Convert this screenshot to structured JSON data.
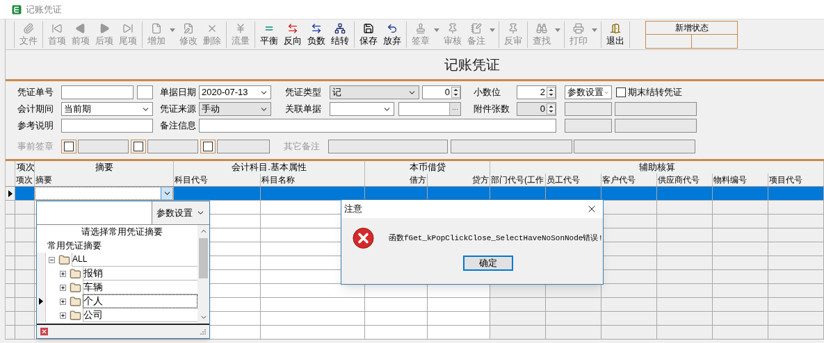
{
  "window": {
    "title": "记账凭证"
  },
  "toolbar": {
    "groups": [
      [
        {
          "label": "文件",
          "disabled": true,
          "dropdown": false
        }
      ],
      [
        {
          "label": "首项",
          "disabled": true,
          "dropdown": false
        },
        {
          "label": "前项",
          "disabled": true,
          "dropdown": false
        },
        {
          "label": "后项",
          "disabled": true,
          "dropdown": false
        },
        {
          "label": "尾项",
          "disabled": true,
          "dropdown": false
        }
      ],
      [
        {
          "label": "增加",
          "disabled": true,
          "dropdown": true
        },
        {
          "label": "修改",
          "disabled": true,
          "dropdown": false
        },
        {
          "label": "删除",
          "disabled": true,
          "dropdown": false
        }
      ],
      [
        {
          "label": "流量",
          "disabled": true,
          "dropdown": false
        }
      ],
      [
        {
          "label": "平衡",
          "disabled": false,
          "dropdown": false
        },
        {
          "label": "反向",
          "disabled": false,
          "dropdown": false
        },
        {
          "label": "负数",
          "disabled": false,
          "dropdown": false
        },
        {
          "label": "结转",
          "disabled": false,
          "dropdown": false
        }
      ],
      [
        {
          "label": "保存",
          "disabled": false,
          "dropdown": false
        },
        {
          "label": "放弃",
          "disabled": false,
          "dropdown": false
        }
      ],
      [
        {
          "label": "签章",
          "disabled": true,
          "dropdown": true
        },
        {
          "label": "审核",
          "disabled": true,
          "dropdown": false
        },
        {
          "label": "备注",
          "disabled": true,
          "dropdown": true
        }
      ],
      [
        {
          "label": "反审",
          "disabled": true,
          "dropdown": false
        }
      ],
      [
        {
          "label": "查找",
          "disabled": true,
          "dropdown": true
        }
      ],
      [
        {
          "label": "打印",
          "disabled": true,
          "dropdown": true
        }
      ],
      [
        {
          "label": "退出",
          "disabled": false,
          "dropdown": false
        }
      ]
    ],
    "status": "新增状态"
  },
  "heading": "记账凭证",
  "form": {
    "voucher_no": {
      "label": "凭证单号"
    },
    "date": {
      "label": "单据日期",
      "value": "2020-07-13"
    },
    "voucher_type": {
      "label": "凭证类型",
      "value": "记",
      "number": "0"
    },
    "decimals": {
      "label": "小数位",
      "value": "2"
    },
    "settings": {
      "value": "参数设置"
    },
    "period_end_transfer": {
      "label": "期末结转凭证",
      "checked": false
    },
    "period": {
      "label": "会计期间",
      "value": "当前期"
    },
    "source": {
      "label": "凭证来源",
      "value": "手动"
    },
    "related_doc": {
      "label": "关联单据",
      "button": "···"
    },
    "attachments": {
      "label": "附件张数",
      "value": "0"
    },
    "reference": {
      "label": "参考说明"
    },
    "remark": {
      "label": "备注信息"
    },
    "pre_signature": {
      "label": "事前签章",
      "disabled": true,
      "checkboxes": [
        {
          "checked": false
        },
        {
          "checked": false
        },
        {
          "checked": false
        }
      ]
    },
    "other_remark": {
      "label": "其它备注",
      "disabled": true
    }
  },
  "table": {
    "group_headers": [
      "项次",
      "摘要",
      "会计科目.基本属性",
      "本币借贷",
      "辅助核算"
    ],
    "columns": [
      "项次",
      "摘要",
      "科目代号",
      "科目名称",
      "借方",
      "贷方",
      "部门代号(工作",
      "员工代号",
      "客户代号",
      "供应商代号",
      "物料编号",
      "项目代号"
    ],
    "rows": [
      {
        "selected": true
      },
      {
        "selected": false
      },
      {
        "selected": false
      },
      {
        "selected": false
      },
      {
        "selected": false
      },
      {
        "selected": false
      },
      {
        "selected": false
      },
      {
        "selected": false
      },
      {
        "selected": false
      },
      {
        "selected": false
      },
      {
        "selected": false
      }
    ]
  },
  "summary_popup": {
    "settings": "参数设置",
    "title": "请选择常用凭证摘要",
    "subtitle": "常用凭证摘要",
    "tree": [
      {
        "label": "ALL",
        "expanded": true,
        "selected": false,
        "children": [
          {
            "label": "报销",
            "expanded": false,
            "selected": false
          },
          {
            "label": "车辆",
            "expanded": false,
            "selected": false
          },
          {
            "label": "个人",
            "expanded": false,
            "selected": true
          },
          {
            "label": "公司",
            "expanded": false,
            "selected": false
          }
        ]
      }
    ]
  },
  "dialog": {
    "title": "注意",
    "message": "函数fGet_kPopClickClose_SelectHaveNoSonNode错误!",
    "button": "确定"
  }
}
